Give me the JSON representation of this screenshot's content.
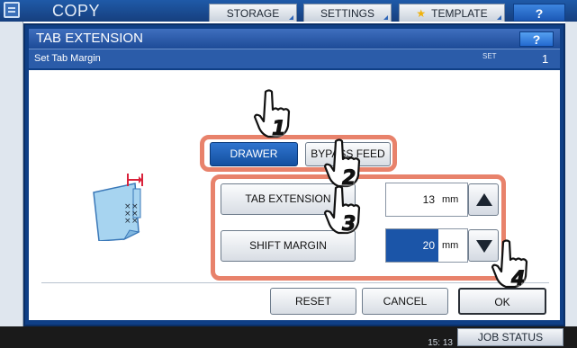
{
  "background": {
    "title": "COPY",
    "tabs": [
      {
        "label": "STORAGE"
      },
      {
        "label": "SETTINGS"
      },
      {
        "label": "TEMPLATE"
      }
    ],
    "help_label": "?",
    "time": "15: 13",
    "job_status_label": "JOB STATUS"
  },
  "dialog": {
    "title": "TAB EXTENSION",
    "help_label": "?",
    "subtitle": "Set Tab Margin",
    "set_label": "SET",
    "set_number": "1",
    "source_buttons": {
      "drawer": "DRAWER",
      "bypass": "BYPASS FEED",
      "selected": "drawer"
    },
    "tab_extension": {
      "label": "TAB EXTENSION",
      "value": "13",
      "unit": "mm"
    },
    "shift_margin": {
      "label": "SHIFT MARGIN",
      "value": "20",
      "unit": "mm"
    },
    "footer": {
      "reset": "RESET",
      "cancel": "CANCEL",
      "ok": "OK"
    }
  },
  "steps": [
    "1",
    "2",
    "3",
    "4"
  ],
  "colors": {
    "highlight": "#e8826b",
    "selected_button": "#1b55a8",
    "header_blue": "#1d4b97"
  }
}
